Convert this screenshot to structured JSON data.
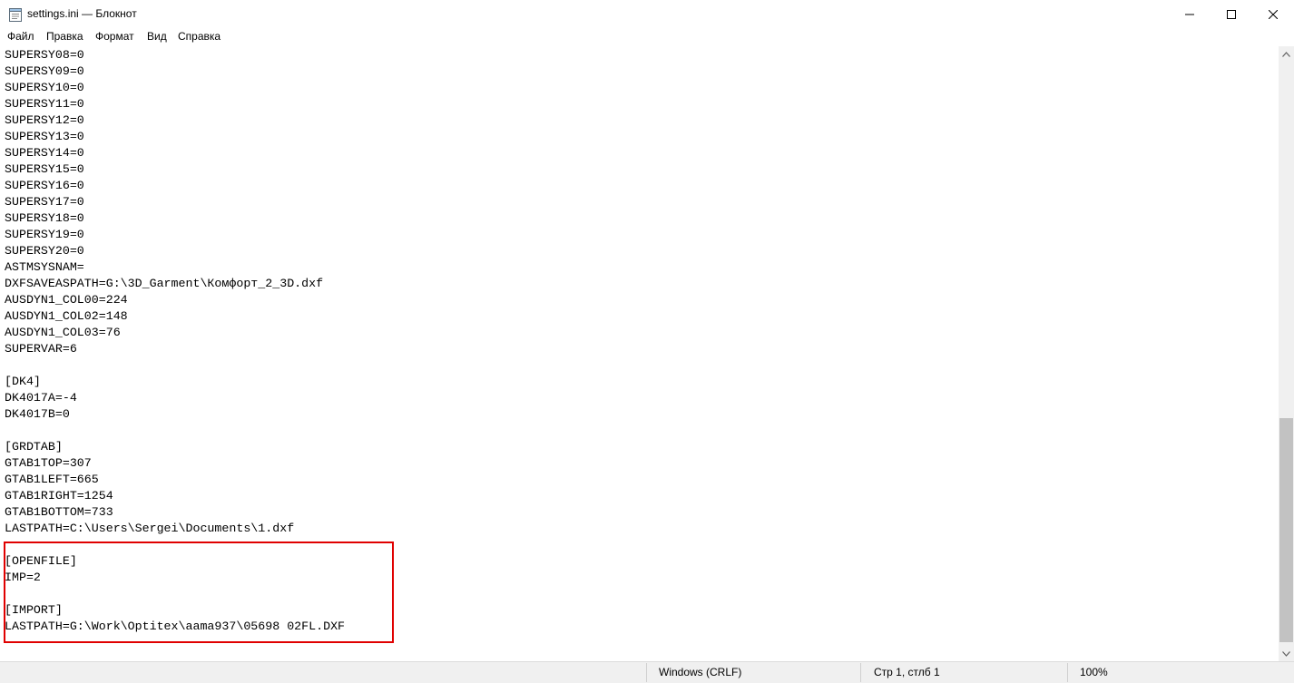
{
  "window": {
    "title": "settings.ini — Блокнот",
    "icons": {
      "app": "notepad-icon",
      "minimize": "minimize-icon",
      "maximize": "maximize-icon",
      "close": "close-icon"
    }
  },
  "menu": {
    "items": [
      "Файл",
      "Правка",
      "Формат",
      "Вид",
      "Справка"
    ]
  },
  "editor": {
    "lines": [
      "SUPERSY08=0",
      "SUPERSY09=0",
      "SUPERSY10=0",
      "SUPERSY11=0",
      "SUPERSY12=0",
      "SUPERSY13=0",
      "SUPERSY14=0",
      "SUPERSY15=0",
      "SUPERSY16=0",
      "SUPERSY17=0",
      "SUPERSY18=0",
      "SUPERSY19=0",
      "SUPERSY20=0",
      "ASTMSYSNAM=",
      "DXFSAVEASPATH=G:\\3D_Garment\\Комфорт_2_3D.dxf",
      "AUSDYN1_COL00=224",
      "AUSDYN1_COL02=148",
      "AUSDYN1_COL03=76",
      "SUPERVAR=6",
      "",
      "[DK4]",
      "DK4017A=-4",
      "DK4017B=0",
      "",
      "[GRDTAB]",
      "GTAB1TOP=307",
      "GTAB1LEFT=665",
      "GTAB1RIGHT=1254",
      "GTAB1BOTTOM=733",
      "LASTPATH=C:\\Users\\Sergei\\Documents\\1.dxf",
      "",
      "[OPENFILE]",
      "IMP=2",
      "",
      "[IMPORT]",
      "LASTPATH=G:\\Work\\Optitex\\aama937\\05698 02FL.DXF"
    ],
    "highlight_color": "#e00000"
  },
  "statusbar": {
    "line_ending": "Windows (CRLF)",
    "position": "Стр 1, стлб 1",
    "zoom": "100%"
  }
}
